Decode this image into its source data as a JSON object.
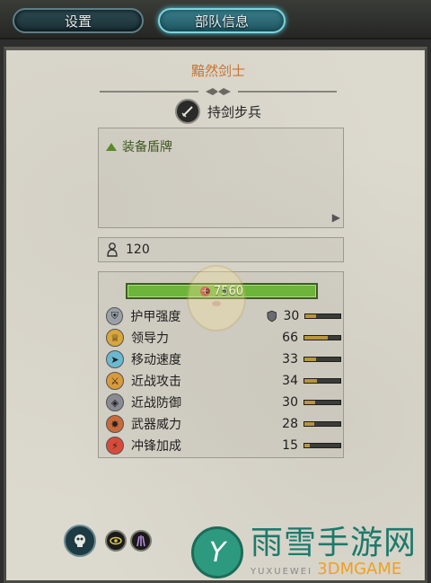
{
  "tabs": [
    {
      "label": "设置",
      "active": false
    },
    {
      "label": "部队信息",
      "active": true
    }
  ],
  "unit": {
    "name": "黯然剑士",
    "class_label": "持剑步兵",
    "class_icon": "sword-icon"
  },
  "abilities": {
    "items": [
      "装备盾牌"
    ],
    "more_icon": "chevron-right-icon"
  },
  "unit_count": "120",
  "hp": "7560",
  "stats": [
    {
      "label": "护甲强度",
      "value": "30",
      "icon": "armor-icon",
      "fill": 0.3,
      "has_shield": true
    },
    {
      "label": "领导力",
      "value": "66",
      "icon": "leadership-icon",
      "fill": 0.66,
      "has_shield": false
    },
    {
      "label": "移动速度",
      "value": "33",
      "icon": "speed-icon",
      "fill": 0.33,
      "has_shield": false
    },
    {
      "label": "近战攻击",
      "value": "34",
      "icon": "melee-attack-icon",
      "fill": 0.34,
      "has_shield": false
    },
    {
      "label": "近战防御",
      "value": "30",
      "icon": "melee-defense-icon",
      "fill": 0.3,
      "has_shield": false
    },
    {
      "label": "武器威力",
      "value": "28",
      "icon": "weapon-strength-icon",
      "fill": 0.28,
      "has_shield": false
    },
    {
      "label": "冲锋加成",
      "value": "15",
      "icon": "charge-bonus-icon",
      "fill": 0.15,
      "has_shield": false
    }
  ],
  "colors": {
    "unit_name": "#c7742e",
    "ability_text": "#3f5a1f",
    "hp_bar": "#6cb53a",
    "stat_fill": "#b8953e",
    "tab_active_glow": "#4fd0e0"
  },
  "watermark": {
    "logo_letter": "Y",
    "cn": "雨雪手游网",
    "en_left": "YUXUEWEI",
    "en_right": "3DMGAME"
  }
}
